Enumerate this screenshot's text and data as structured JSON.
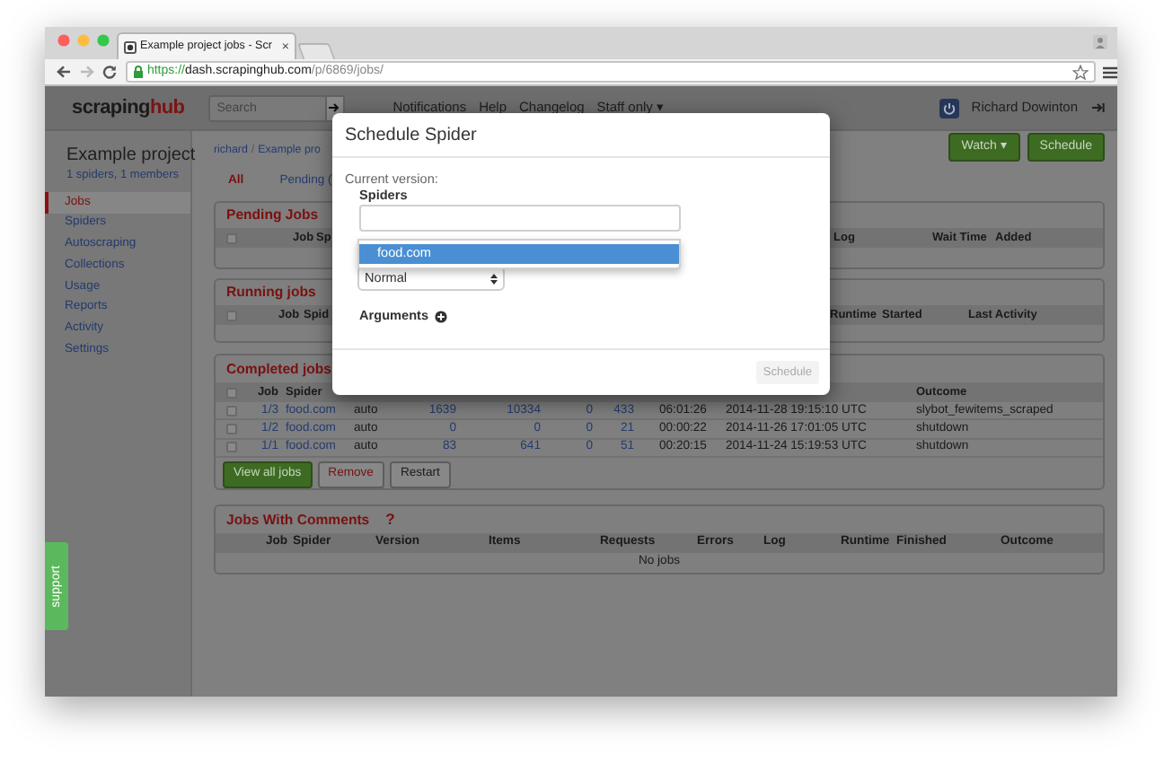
{
  "browser": {
    "tab_title": "Example project jobs - Scr",
    "tab_close": "×",
    "url": {
      "scheme": "https://",
      "host": "dash.scrapinghub.com",
      "path": "/p/6869/jobs/"
    }
  },
  "navbar": {
    "logo": {
      "text": "scraping",
      "accent": "hub"
    },
    "search": {
      "placeholder": "Search"
    },
    "links": [
      "Notifications",
      "Help",
      "Changelog",
      "Staff only ▾"
    ],
    "user": "Richard Dowinton"
  },
  "sidebar": {
    "project": "Example project",
    "meta": "1 spiders, 1 members",
    "items": [
      {
        "label": "Jobs",
        "selected": true
      },
      {
        "label": "Spiders",
        "selected": false
      },
      {
        "label": "Autoscraping",
        "selected": false
      },
      {
        "label": "Collections",
        "selected": false
      },
      {
        "label": "Usage",
        "selected": false
      },
      {
        "label": "Reports",
        "selected": false
      },
      {
        "label": "Activity",
        "selected": false
      },
      {
        "label": "Settings",
        "selected": false
      }
    ]
  },
  "support": "support",
  "breadcrumb": [
    "richard",
    "/",
    "Example pro"
  ],
  "tabs": [
    {
      "label": "All",
      "selected": true
    },
    {
      "label": "Pending (",
      "selected": false
    }
  ],
  "actions": [
    "Watch ▾",
    "Schedule"
  ],
  "pending_jobs": {
    "title": "Pending Jobs",
    "select_all_checked": false,
    "columns": [
      "Job",
      "Sp",
      "Log",
      "Wait Time",
      "Added"
    ]
  },
  "running_jobs": {
    "title": "Running jobs",
    "select_all_checked": false,
    "columns": [
      "Job",
      "Spid",
      "Runtime",
      "Started",
      "Last Activity"
    ]
  },
  "completed_jobs": {
    "title": "Completed jobs",
    "select_all_checked": false,
    "columns": [
      "Job",
      "Spider",
      null,
      null,
      null,
      null,
      null,
      null,
      null,
      "Outcome"
    ],
    "rows": [
      {
        "checked": false,
        "cells": [
          "1/3",
          "food.com",
          "auto",
          "1639",
          "10334",
          "0",
          "433",
          "06:01:26",
          "2014-11-28 19:15:10 UTC",
          "slybot_fewitems_scraped"
        ]
      },
      {
        "checked": false,
        "cells": [
          "1/2",
          "food.com",
          "auto",
          "0",
          "0",
          "0",
          "21",
          "00:00:22",
          "2014-11-26 17:01:05 UTC",
          "shutdown"
        ]
      },
      {
        "checked": false,
        "cells": [
          "1/1",
          "food.com",
          "auto",
          "83",
          "641",
          "0",
          "51",
          "00:20:15",
          "2014-11-24 15:19:53 UTC",
          "shutdown"
        ]
      }
    ],
    "buttons": [
      {
        "label": "View all jobs",
        "kind": "primary"
      },
      {
        "label": "Remove",
        "kind": "danger"
      },
      {
        "label": "Restart",
        "kind": "default"
      }
    ]
  },
  "jobs_with_comments": {
    "title": "Jobs With Comments",
    "help": "?",
    "columns": [
      "Job",
      "Spider",
      "Version",
      "Items",
      "Requests",
      "Errors",
      "Log",
      "Runtime",
      "Finished",
      "Outcome"
    ],
    "empty": "No jobs"
  },
  "modal": {
    "title": "Schedule Spider",
    "current_version": "Current version:",
    "spiders_label": "Spiders",
    "suggestions": [
      {
        "label": "food.com",
        "selected": true
      }
    ],
    "priority": "Normal",
    "arguments": "Arguments",
    "submit": {
      "label": "Schedule",
      "disabled": true
    }
  }
}
